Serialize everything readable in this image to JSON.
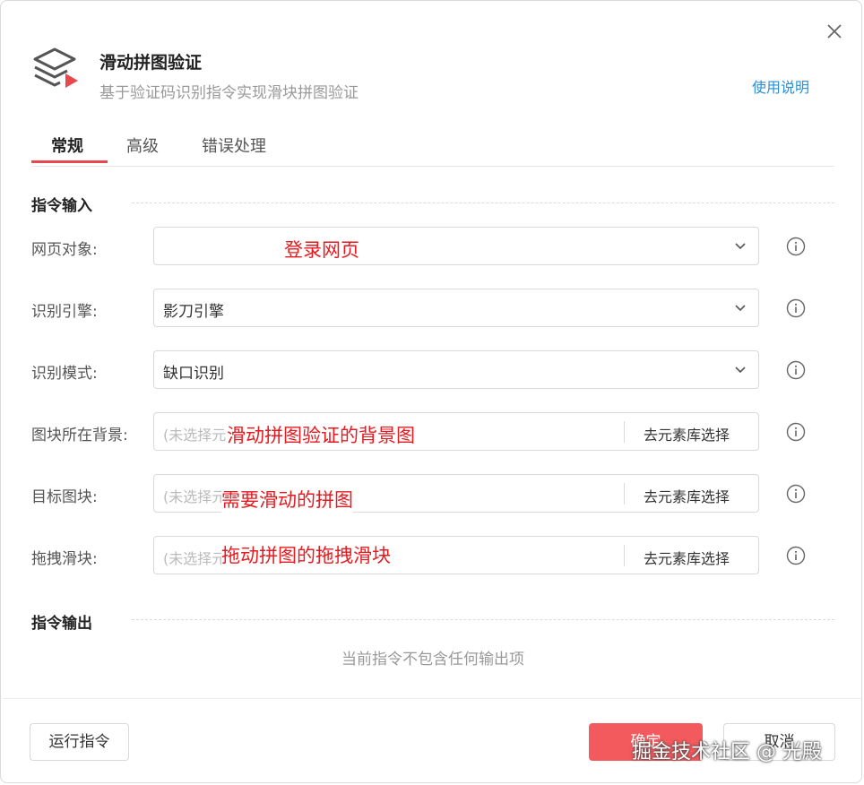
{
  "header": {
    "title": "滑动拼图验证",
    "subtitle": "基于验证码识别指令实现滑块拼图验证",
    "help_link": "使用说明"
  },
  "tabs": [
    {
      "label": "常规",
      "active": true
    },
    {
      "label": "高级",
      "active": false
    },
    {
      "label": "错误处理",
      "active": false
    }
  ],
  "input_section": {
    "title": "指令输入",
    "rows": [
      {
        "label": "网页对象:",
        "value": ""
      },
      {
        "label": "识别引擎:",
        "value": "影刀引擎"
      },
      {
        "label": "识别模式:",
        "value": "缺口识别"
      },
      {
        "label": "图块所在背景:",
        "placeholder": "(未选择元素)",
        "button": "去元素库选择"
      },
      {
        "label": "目标图块:",
        "placeholder": "(未选择元素)",
        "button": "去元素库选择"
      },
      {
        "label": "拖拽滑块:",
        "placeholder": "(未选择元素)",
        "button": "去元素库选择"
      }
    ]
  },
  "annotations": [
    "登录网页",
    "滑动拼图验证的背景图",
    "需要滑动的拼图",
    "拖动拼图的拖拽滑块"
  ],
  "output_section": {
    "title": "指令输出",
    "empty_text": "当前指令不包含任何输出项"
  },
  "footer": {
    "run_button": "运行指令",
    "confirm_button": "确定",
    "cancel_button": "取消"
  },
  "watermark": "掘金技术社区 @ 光殿",
  "colors": {
    "accent": "#e8474d",
    "link": "#2b8fd6",
    "annotation": "#e8191f",
    "primary_button": "#f25a5d"
  }
}
